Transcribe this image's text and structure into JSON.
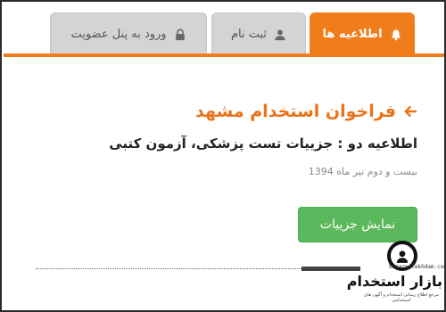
{
  "tabs": [
    {
      "label": "اطلاعیه ها",
      "icon": "bell-icon",
      "active": true
    },
    {
      "label": "ثبت نام",
      "icon": "user-icon",
      "active": false
    },
    {
      "label": "ورود به پنل عضویت",
      "icon": "lock-icon",
      "active": false
    }
  ],
  "main": {
    "title": "فراخوان استخدام مشهد",
    "title_icon": "arrow-left-icon",
    "subtitle": "اطلاعیه دو : جزییات تست پزشکی، آزمون کتبی",
    "date": "بیست و دوم تیر ماه 1394",
    "details_button": "نمایش جزییات"
  },
  "watermark": {
    "brand": "بازار استخدام",
    "site": "bazarestekhdam.com",
    "tagline": "مرجع اطلاع رسانی استخدام و آگهی های استخدامی"
  },
  "colors": {
    "accent": "#f07d1a",
    "title": "#e8731a",
    "button": "#5cb85c"
  }
}
